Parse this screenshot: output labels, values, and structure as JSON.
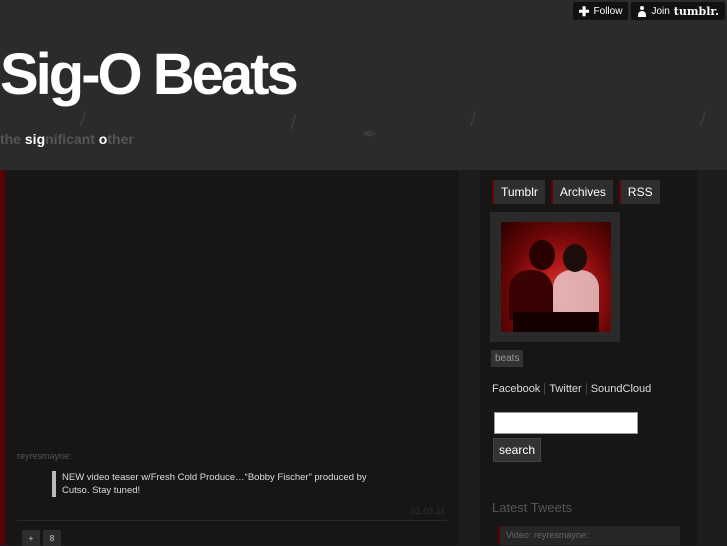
{
  "header": {
    "title": "Sig-O Beats",
    "tagline": {
      "p1": "the ",
      "sig": "sig",
      "p2": "nificant ",
      "o": "o",
      "p3": "ther"
    }
  },
  "topbar": {
    "follow_label": "Follow",
    "join_label": "Join",
    "brand": "tumblr."
  },
  "post": {
    "username": "reyresmayne",
    "quote": "NEW video teaser w/Fresh Cold Produce…“Bobby Fischer” produced by Cutso. Stay tuned!",
    "date": "01.03.11",
    "actions": [
      "+",
      "8"
    ]
  },
  "sidebar": {
    "nav": [
      "Tumblr",
      "Archives",
      "RSS"
    ],
    "tag": "beats",
    "links": [
      "Facebook",
      "Twitter",
      "SoundCloud"
    ],
    "search_button": "search",
    "search_value": "",
    "latest_title": "Latest Tweets",
    "tweet_preview": "Video: reyresmayne:"
  },
  "colors": {
    "accent": "#6a0000",
    "header_bg": "#2b2b2b",
    "content_bg": "#161616"
  },
  "icons": [
    "plus-icon",
    "person-icon"
  ]
}
